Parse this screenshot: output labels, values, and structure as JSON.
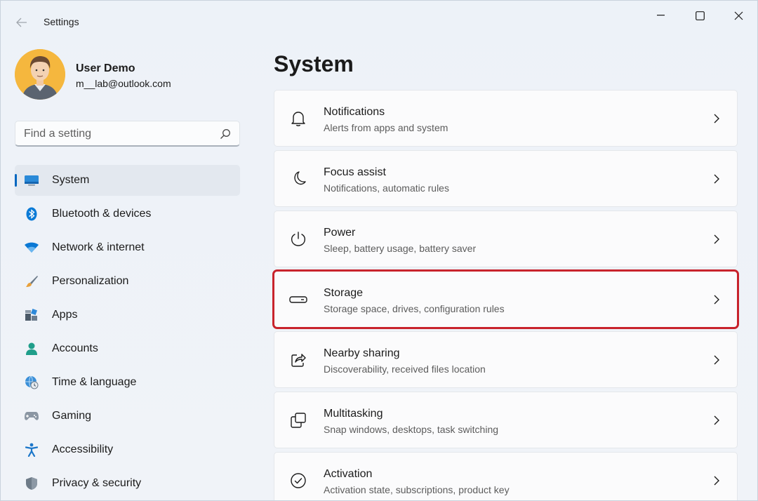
{
  "app": {
    "title": "Settings"
  },
  "user": {
    "name": "User Demo",
    "email": "m__lab@outlook.com"
  },
  "search": {
    "placeholder": "Find a setting"
  },
  "sidebar": {
    "items": [
      {
        "label": "System",
        "icon": "system-display-icon",
        "active": true
      },
      {
        "label": "Bluetooth & devices",
        "icon": "bluetooth-icon"
      },
      {
        "label": "Network & internet",
        "icon": "wifi-icon"
      },
      {
        "label": "Personalization",
        "icon": "brush-icon"
      },
      {
        "label": "Apps",
        "icon": "apps-icon"
      },
      {
        "label": "Accounts",
        "icon": "person-icon"
      },
      {
        "label": "Time & language",
        "icon": "globe-clock-icon"
      },
      {
        "label": "Gaming",
        "icon": "gamepad-icon"
      },
      {
        "label": "Accessibility",
        "icon": "accessibility-icon"
      },
      {
        "label": "Privacy & security",
        "icon": "shield-icon"
      }
    ]
  },
  "main": {
    "title": "System",
    "cards": [
      {
        "title": "Notifications",
        "subtitle": "Alerts from apps and system",
        "icon": "bell-icon"
      },
      {
        "title": "Focus assist",
        "subtitle": "Notifications, automatic rules",
        "icon": "moon-icon"
      },
      {
        "title": "Power",
        "subtitle": "Sleep, battery usage, battery saver",
        "icon": "power-icon"
      },
      {
        "title": "Storage",
        "subtitle": "Storage space, drives, configuration rules",
        "icon": "drive-icon",
        "highlighted": true
      },
      {
        "title": "Nearby sharing",
        "subtitle": "Discoverability, received files location",
        "icon": "share-icon"
      },
      {
        "title": "Multitasking",
        "subtitle": "Snap windows, desktops, task switching",
        "icon": "multitask-icon"
      },
      {
        "title": "Activation",
        "subtitle": "Activation state, subscriptions, product key",
        "icon": "check-circle-icon"
      }
    ]
  },
  "colors": {
    "accent": "#0067c0",
    "highlight": "#c8232c"
  }
}
